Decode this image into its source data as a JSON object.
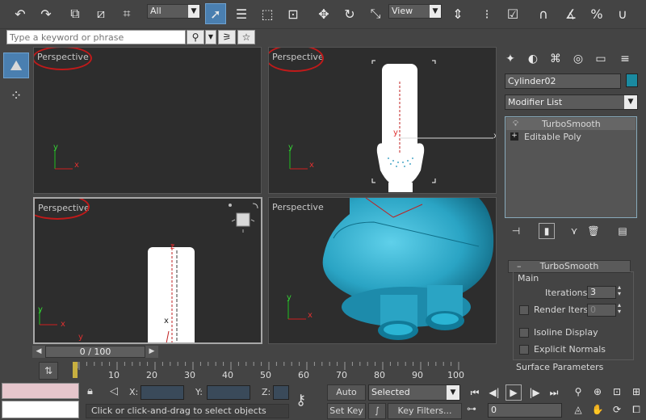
{
  "toolbar": {
    "selection_filter": "All",
    "ref_coord": "View"
  },
  "search": {
    "placeholder": "Type a keyword or phrase"
  },
  "viewports": {
    "top_left": {
      "label": "Perspective"
    },
    "top_right": {
      "label": "Perspective"
    },
    "bottom_left": {
      "label": "Perspective"
    },
    "bottom_right": {
      "label": "Perspective"
    }
  },
  "axes": {
    "x": "x",
    "y": "y",
    "z": "z"
  },
  "command_panel": {
    "object_name": "Cylinder02",
    "object_color": "#1a8aa0",
    "modifier_list": "Modifier List",
    "stack": [
      {
        "label": "TurboSmooth"
      },
      {
        "label": "Editable Poly"
      }
    ],
    "rollout_title": "TurboSmooth",
    "main_group": "Main",
    "iterations_label": "Iterations:",
    "iterations_value": "3",
    "render_iters_label": "Render Iters:",
    "render_iters_value": "0",
    "isoline_label": "Isoline Display",
    "explicit_normals_label": "Explicit Normals",
    "surface_params": "Surface Parameters"
  },
  "timeline": {
    "frame_display": "0 / 100",
    "ticks": [
      "10",
      "20",
      "30",
      "40",
      "50",
      "60",
      "70",
      "80",
      "90",
      "100"
    ]
  },
  "status": {
    "prompt": "Click or click-and-drag to select objects",
    "x_label": "X:",
    "y_label": "Y:",
    "z_label": "Z:",
    "auto_key": "Auto Key",
    "set_key": "Set Key",
    "key_mode": "Selected",
    "key_filters": "Key Filters...",
    "current_frame": "0"
  },
  "colors": {
    "annotation_red": "#c01a1a",
    "viewport_bg": "#2d2d2d",
    "object_teal": "#2aa4c4",
    "accent_blue": "#4a7fb0"
  }
}
